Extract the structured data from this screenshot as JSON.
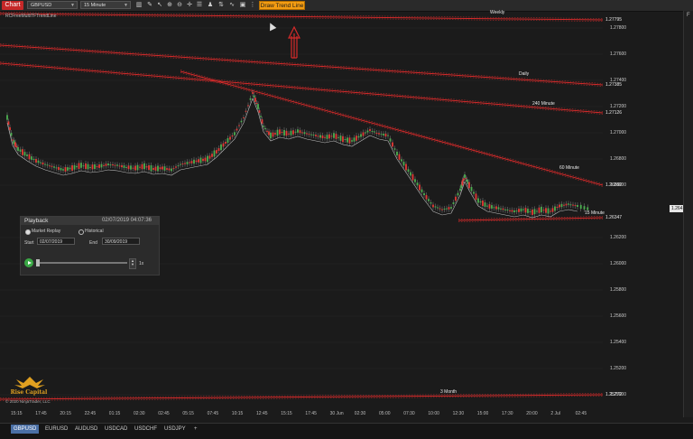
{
  "toolbar": {
    "chart_label": "Chart",
    "instrument": "GBPUSD",
    "interval": "15 Minute",
    "draw_button": "Draw Trend Line",
    "icons": [
      "bar-style-icon",
      "draw-tools-icon",
      "pointer-icon",
      "zoom-in-icon",
      "zoom-out-icon",
      "crosshair-icon",
      "properties-icon",
      "strategies-icon",
      "chart-trader-icon",
      "indicators-icon",
      "screenshot-icon"
    ],
    "indicator_label": "RCFreeMultiTFTrendLine"
  },
  "price_axis": {
    "labels": [
      "1.27800",
      "1.27600",
      "1.27400",
      "1.27200",
      "1.27000",
      "1.26800",
      "1.26600",
      "1.26200",
      "1.26000",
      "1.25800",
      "1.25600",
      "1.25400",
      "1.25200",
      "1.25000"
    ],
    "current_price": "1.26413"
  },
  "trend_lines": [
    {
      "name": "Weekly",
      "price": "1.27795"
    },
    {
      "name": "Daily",
      "price": "1.27385"
    },
    {
      "name": "240 Minute",
      "price": "1.27126"
    },
    {
      "name": "60 Minute",
      "price": "1.26582"
    },
    {
      "name": "15 Minute",
      "price": "1.26347"
    },
    {
      "name": "3 Month",
      "price": "1.25772"
    }
  ],
  "time_axis": [
    "15:15",
    "17:45",
    "20:15",
    "22:45",
    "01:15",
    "02:30",
    "02:45",
    "05:15",
    "07:45",
    "10:15",
    "12:45",
    "15:15",
    "17:45",
    "30 Jun",
    "02:30",
    "05:00",
    "07:30",
    "10:00",
    "12:30",
    "15:00",
    "17:30",
    "20:00",
    "2 Jul",
    "02:45"
  ],
  "playback": {
    "title": "Playback",
    "datetime": "02/07/2019 04:07:36",
    "mode_market_replay": "Market Replay",
    "mode_historical": "Historical",
    "start_label": "Start",
    "start_value": "02/07/2019",
    "end_label": "End",
    "end_value": "30/09/2019",
    "speed": "1x"
  },
  "copyright": "© 2020 NinjaTrader, LLC",
  "logo_text": "Rise Capital",
  "tabs": [
    "GBPUSD",
    "EURUSD",
    "AUDUSD",
    "USDCAD",
    "USDCHF",
    "USDJPY",
    "+"
  ],
  "colors": {
    "background": "#1b1b1b",
    "trend_line": "#d42a2a",
    "candle_up": "#4caf50",
    "candle_down": "#e53935",
    "accent": "#f39c12",
    "active_tab": "#4a6fa5"
  }
}
